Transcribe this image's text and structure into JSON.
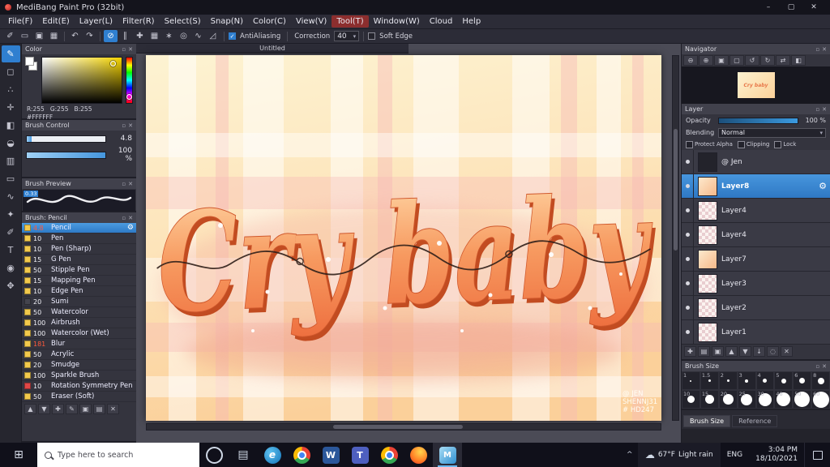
{
  "window": {
    "title": "MediBang Paint Pro (32bit)",
    "minimize": "–",
    "maximize": "▢",
    "close": "✕"
  },
  "menu": {
    "items": [
      "File(F)",
      "Edit(E)",
      "Layer(L)",
      "Filter(R)",
      "Select(S)",
      "Snap(N)",
      "Color(C)",
      "View(V)",
      "Tool(T)",
      "Window(W)",
      "Cloud",
      "Help"
    ],
    "highlighted": "Tool(T)"
  },
  "toolbar": {
    "icons": [
      {
        "id": "select-pen",
        "glyph": "✐"
      },
      {
        "id": "marquee",
        "glyph": "▭"
      },
      {
        "id": "transform",
        "glyph": "▣"
      },
      {
        "id": "grid-view",
        "glyph": "▦"
      },
      {
        "sep": true
      },
      {
        "id": "undo",
        "glyph": "↶"
      },
      {
        "id": "redo",
        "glyph": "↷"
      },
      {
        "sep": true
      },
      {
        "id": "snap-off",
        "glyph": "⊘",
        "active": true
      },
      {
        "id": "snap-parallel",
        "glyph": "∥"
      },
      {
        "id": "snap-cross",
        "glyph": "✚"
      },
      {
        "id": "snap-grid",
        "glyph": "▦"
      },
      {
        "id": "snap-radial",
        "glyph": "∗"
      },
      {
        "id": "snap-circle",
        "glyph": "◎"
      },
      {
        "id": "snap-curve",
        "glyph": "∿"
      },
      {
        "id": "snap-vanish",
        "glyph": "◿"
      }
    ],
    "antialiasing": {
      "label": "AntiAliasing",
      "checked": true
    },
    "correction": {
      "label": "Correction",
      "value": "40"
    },
    "soft_edge": {
      "label": "Soft Edge",
      "checked": false
    }
  },
  "tools": [
    {
      "id": "brush-tool",
      "glyph": "✎",
      "active": true
    },
    {
      "id": "eraser-tool",
      "glyph": "◻"
    },
    {
      "id": "dot-pen-tool",
      "glyph": "∴"
    },
    {
      "id": "move-tool",
      "glyph": "✛"
    },
    {
      "id": "fill-tool",
      "glyph": "◧"
    },
    {
      "id": "bucket-tool",
      "glyph": "◒"
    },
    {
      "id": "gradient-tool",
      "glyph": "▥"
    },
    {
      "id": "select-tool",
      "glyph": "▭"
    },
    {
      "id": "lasso-tool",
      "glyph": "∿"
    },
    {
      "id": "magic-wand-tool",
      "glyph": "✦"
    },
    {
      "id": "select-pen-tool",
      "glyph": "✐"
    },
    {
      "id": "text-tool",
      "glyph": "T"
    },
    {
      "id": "eyedropper-tool",
      "glyph": "◉"
    },
    {
      "id": "hand-tool",
      "glyph": "✥"
    }
  ],
  "color_panel": {
    "title": "Color",
    "r": "R:255",
    "g": "G:255",
    "b": "B:255",
    "hex": "#FFFFFF",
    "hue": "#f5d400"
  },
  "brush_control": {
    "title": "Brush Control",
    "size_value": "4.8",
    "size_fill": 6,
    "opacity_value": "100 %",
    "opacity_fill": 100
  },
  "brush_preview": {
    "title": "Brush Preview",
    "badge": "0.33"
  },
  "brush_panel": {
    "title": "Brush: Pencil",
    "brushes": [
      {
        "size": "4.8",
        "name": "Pencil",
        "swatch": "#f2c94c",
        "size_color": "#ff5a3c",
        "selected": true
      },
      {
        "size": "10",
        "name": "Pen",
        "swatch": "#f2c94c"
      },
      {
        "size": "10",
        "name": "Pen (Sharp)",
        "swatch": "#f2c94c"
      },
      {
        "size": "15",
        "name": "G Pen",
        "swatch": "#f2c94c"
      },
      {
        "size": "50",
        "name": "Stipple Pen",
        "swatch": "#f2c94c"
      },
      {
        "size": "15",
        "name": "Mapping Pen",
        "swatch": "#f2c94c"
      },
      {
        "size": "10",
        "name": "Edge Pen",
        "swatch": "#f2c94c"
      },
      {
        "size": "20",
        "name": "Sumi",
        "swatch": "#44444e"
      },
      {
        "size": "50",
        "name": "Watercolor",
        "swatch": "#f2c94c"
      },
      {
        "size": "100",
        "name": "Airbrush",
        "swatch": "#f2c94c"
      },
      {
        "size": "100",
        "name": "Watercolor (Wet)",
        "swatch": "#f2c94c"
      },
      {
        "size": "181",
        "name": "Blur",
        "swatch": "#f2c94c",
        "size_color": "#ff5a3c"
      },
      {
        "size": "50",
        "name": "Acrylic",
        "swatch": "#f2c94c"
      },
      {
        "size": "20",
        "name": "Smudge",
        "swatch": "#f2c94c"
      },
      {
        "size": "100",
        "name": "Sparkle Brush",
        "swatch": "#f2c94c"
      },
      {
        "size": "10",
        "name": "Rotation Symmetry Pen",
        "swatch": "#e04747"
      },
      {
        "size": "50",
        "name": "Eraser (Soft)",
        "swatch": "#f2c94c"
      }
    ],
    "footer_icons": [
      {
        "id": "move-brush-up",
        "glyph": "▲"
      },
      {
        "id": "move-brush-down",
        "glyph": "▼"
      },
      {
        "id": "add-brush",
        "glyph": "✚"
      },
      {
        "id": "edit-brush",
        "glyph": "✎"
      },
      {
        "id": "duplicate-brush",
        "glyph": "▣"
      },
      {
        "id": "brush-folder",
        "glyph": "▤"
      },
      {
        "id": "delete-brush",
        "glyph": "✕"
      }
    ]
  },
  "canvas": {
    "tab_title": "Untitled",
    "artwork_text": "Cry baby",
    "signature_lines": [
      "@ JEN",
      "SHENNJ31",
      "# HD247"
    ],
    "colors": {
      "bg_top": "#fdf3d2",
      "bg_mid": "#fde4ba",
      "bg_bottom": "#fbd09a",
      "letter_top": "#ffd9a8",
      "letter_bottom": "#ee6f3f",
      "letter_shadow": "#c24c21",
      "script_line": "#30201a",
      "plaid_pink": "#f6b7b7"
    }
  },
  "navigator": {
    "title": "Navigator",
    "icons": [
      {
        "id": "zoom-out",
        "glyph": "⊖"
      },
      {
        "id": "zoom-in",
        "glyph": "⊕"
      },
      {
        "id": "zoom-100",
        "glyph": "▣"
      },
      {
        "id": "fit-to-window",
        "glyph": "▢"
      },
      {
        "id": "rotate-left",
        "glyph": "↺"
      },
      {
        "id": "rotate-right",
        "glyph": "↻"
      },
      {
        "id": "reset-view",
        "glyph": "⇄"
      },
      {
        "id": "flip-horizontal",
        "glyph": "◧"
      }
    ]
  },
  "layer_panel": {
    "title": "Layer",
    "opacity_label": "Opacity",
    "opacity_value": "100 %",
    "blending_label": "Blending",
    "blending_value": "Normal",
    "checkboxes": [
      {
        "label": "Protect Alpha"
      },
      {
        "label": "Clipping"
      },
      {
        "label": "Lock"
      }
    ],
    "layers": [
      {
        "name": "@ Jen",
        "thumb": "dark"
      },
      {
        "name": "Layer8",
        "thumb": "art",
        "selected": true
      },
      {
        "name": "Layer4",
        "thumb": "checker"
      },
      {
        "name": "Layer4",
        "thumb": "checker"
      },
      {
        "name": "Layer7",
        "thumb": "art"
      },
      {
        "name": "Layer3",
        "thumb": "checker"
      },
      {
        "name": "Layer2",
        "thumb": "checker"
      },
      {
        "name": "Layer1",
        "thumb": "checker"
      }
    ],
    "footer_icons": [
      {
        "id": "add-layer",
        "glyph": "✚"
      },
      {
        "id": "add-folder",
        "glyph": "▤"
      },
      {
        "id": "duplicate-layer",
        "glyph": "▣"
      },
      {
        "id": "move-layer-up",
        "glyph": "▲"
      },
      {
        "id": "move-layer-down",
        "glyph": "▼"
      },
      {
        "id": "merge-layer",
        "glyph": "↓"
      },
      {
        "id": "clear-layer",
        "glyph": "◌"
      },
      {
        "id": "delete-layer",
        "glyph": "✕"
      }
    ]
  },
  "brush_size_panel": {
    "title": "Brush Size",
    "cells": [
      {
        "label": "1",
        "dot": 2
      },
      {
        "label": "1.5",
        "dot": 3
      },
      {
        "label": "2",
        "dot": 3
      },
      {
        "label": "3",
        "dot": 4
      },
      {
        "label": "4",
        "dot": 5
      },
      {
        "label": "5",
        "dot": 6
      },
      {
        "label": "6",
        "dot": 7
      },
      {
        "label": "8",
        "dot": 8
      },
      {
        "label": "10",
        "dot": 9
      },
      {
        "label": "15",
        "dot": 11
      },
      {
        "label": "20",
        "dot": 13
      },
      {
        "label": "25",
        "dot": 14
      },
      {
        "label": "30",
        "dot": 16
      },
      {
        "label": "40",
        "dot": 17
      },
      {
        "label": "50",
        "dot": 19
      },
      {
        "label": "60",
        "dot": 20
      }
    ],
    "tabs": [
      {
        "label": "Brush Size",
        "active": true
      },
      {
        "label": "Reference",
        "active": false
      }
    ]
  },
  "taskbar": {
    "start_glyph": "⊞",
    "search_placeholder": "Type here to search",
    "apps": [
      {
        "id": "cortana",
        "cls": "ic-ring",
        "glyph": ""
      },
      {
        "id": "task-view",
        "cls": "ic-taskview",
        "glyph": "▤"
      },
      {
        "id": "edge",
        "cls": "ic-edge",
        "glyph": "e"
      },
      {
        "id": "chrome",
        "cls": "ic-chrome",
        "glyph": ""
      },
      {
        "id": "word",
        "cls": "ic-word",
        "glyph": "W"
      },
      {
        "id": "teams",
        "cls": "ic-teams",
        "glyph": "T"
      },
      {
        "id": "chrome-profile",
        "cls": "ic-chrome",
        "glyph": ""
      },
      {
        "id": "firefox",
        "cls": "ic-firefox",
        "glyph": ""
      },
      {
        "id": "medibang",
        "cls": "ic-medibang",
        "glyph": "M",
        "active": true
      }
    ],
    "chevron": "^",
    "weather_icon": "☁",
    "weather_temp": "67°F",
    "weather_desc": "Light rain",
    "language": "ENG",
    "time": "3:04 PM",
    "date": "18/10/2021"
  }
}
